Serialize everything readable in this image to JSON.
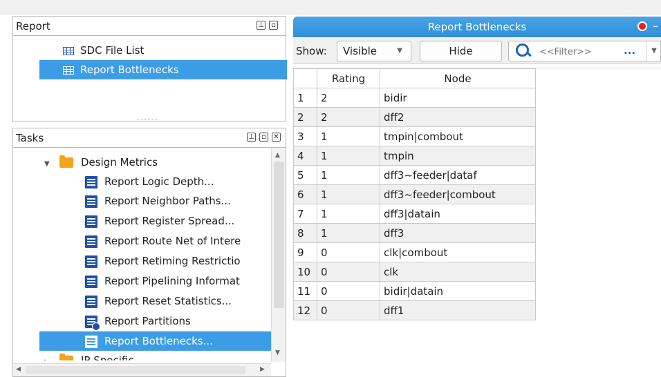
{
  "report_panel": {
    "title": "Report",
    "pin_icon": "pin-icon",
    "float_icon": "float-icon",
    "items": [
      {
        "label": "SDC File List",
        "icon": "table-icon",
        "selected": false
      },
      {
        "label": "Report Bottlenecks",
        "icon": "table-icon",
        "selected": true
      }
    ]
  },
  "tasks_panel": {
    "title": "Tasks",
    "folder": {
      "label": "Design Metrics",
      "expanded": true
    },
    "items": [
      {
        "label": "Report Logic Depth...",
        "icon": "document-icon"
      },
      {
        "label": "Report Neighbor Paths...",
        "icon": "document-icon"
      },
      {
        "label": "Report Register Spread...",
        "icon": "document-icon"
      },
      {
        "label": "Report Route Net of Intere",
        "icon": "document-icon"
      },
      {
        "label": "Report Retiming Restrictio",
        "icon": "document-icon"
      },
      {
        "label": "Report Pipelining Informat",
        "icon": "document-icon"
      },
      {
        "label": "Report Reset Statistics...",
        "icon": "document-icon"
      },
      {
        "label": "Report Partitions",
        "icon": "document-clock-icon"
      },
      {
        "label": "Report Bottlenecks...",
        "icon": "document-icon",
        "selected": true
      }
    ],
    "next_folder": {
      "label": "IP Specific",
      "expanded": false
    }
  },
  "report_view": {
    "tab_title": "Report Bottlenecks",
    "show_label": "Show:",
    "show_value": "Visible",
    "hide_label": "Hide",
    "filter_placeholder": "<<Filter>>",
    "more_label": "...",
    "accent": "#2f8fd8",
    "columns": [
      "",
      "Rating",
      "Node"
    ],
    "rows": [
      [
        "1",
        "2",
        "bidir"
      ],
      [
        "2",
        "2",
        "dff2"
      ],
      [
        "3",
        "1",
        "tmpin|combout"
      ],
      [
        "4",
        "1",
        "tmpin"
      ],
      [
        "5",
        "1",
        "dff3~feeder|dataf"
      ],
      [
        "6",
        "1",
        "dff3~feeder|combout"
      ],
      [
        "7",
        "1",
        "dff3|datain"
      ],
      [
        "8",
        "1",
        "dff3"
      ],
      [
        "9",
        "0",
        "clk|combout"
      ],
      [
        "10",
        "0",
        "clk"
      ],
      [
        "11",
        "0",
        "bidir|datain"
      ],
      [
        "12",
        "0",
        "dff1"
      ]
    ]
  }
}
